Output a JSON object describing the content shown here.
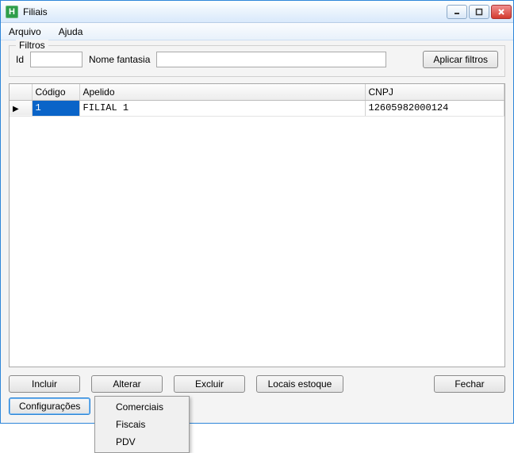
{
  "window": {
    "title": "Filiais",
    "app_icon_letter": "H"
  },
  "menubar": {
    "arquivo": "Arquivo",
    "ajuda": "Ajuda"
  },
  "filtros": {
    "legend": "Filtros",
    "id_label": "Id",
    "id_value": "",
    "nome_label": "Nome fantasia",
    "nome_value": "",
    "aplicar_label": "Aplicar filtros"
  },
  "grid": {
    "headers": {
      "codigo": "Código",
      "apelido": "Apelido",
      "cnpj": "CNPJ"
    },
    "rows": [
      {
        "codigo": "1",
        "apelido": "FILIAL 1",
        "cnpj": "12605982000124"
      }
    ]
  },
  "buttons": {
    "incluir": "Incluir",
    "alterar": "Alterar",
    "excluir": "Excluir",
    "locais": "Locais estoque",
    "fechar": "Fechar",
    "config": "Configurações"
  },
  "context_menu": {
    "comerciais": "Comerciais",
    "fiscais": "Fiscais",
    "pdv": "PDV"
  }
}
